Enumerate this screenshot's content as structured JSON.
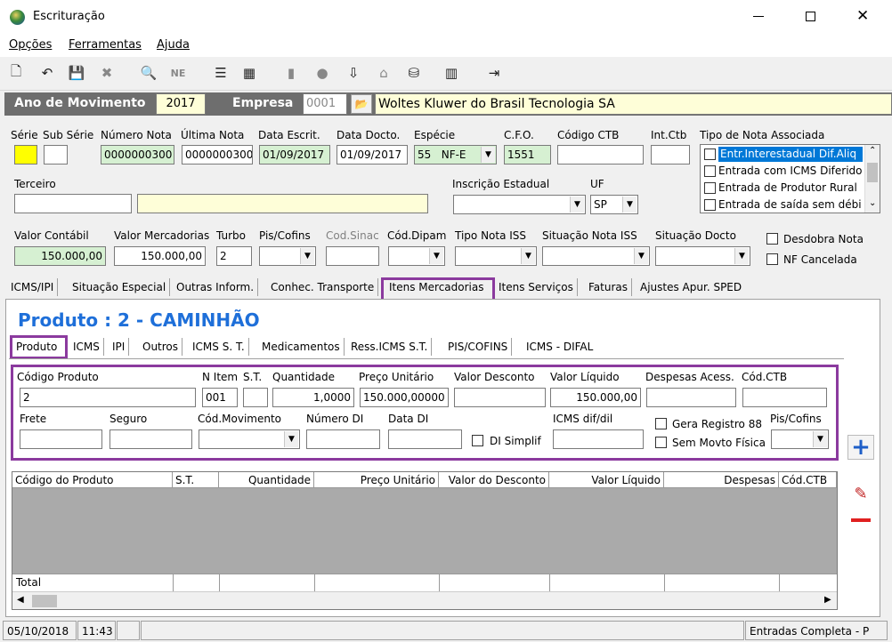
{
  "window": {
    "title": "Escrituração"
  },
  "menu": [
    "Opções",
    "Ferramentas",
    "Ajuda"
  ],
  "header": {
    "ano_label": "Ano de Movimento",
    "ano_value": "2017",
    "empresa_label": "Empresa",
    "empresa_code": "0001",
    "empresa_name": "Woltes Kluwer do Brasil Tecnologia SA"
  },
  "nota": {
    "serie_label": "Série",
    "sub_serie_label": "Sub Série",
    "numero_nota_label": "Número Nota",
    "numero_nota_value": "0000000300",
    "ultima_nota_label": "Última Nota",
    "ultima_nota_value": "0000000300",
    "data_escrit_label": "Data Escrit.",
    "data_escrit_value": "01/09/2017",
    "data_docto_label": "Data Docto.",
    "data_docto_value": "01/09/2017",
    "especie_label": "Espécie",
    "especie_value": "55   NF-E",
    "cfo_label": "C.F.O.",
    "cfo_value": "1551",
    "codigo_ctb_label": "Código CTB",
    "int_ctb_label": "Int.Ctb",
    "tipo_nota_label": "Tipo de Nota Associada",
    "tipo_nota_items": [
      "Entr.Interestadual Dif.Aliq",
      "Entrada com ICMS Diferido",
      "Entrada de Produtor Rural",
      "Entrada de saída sem débi"
    ],
    "terceiro_label": "Terceiro",
    "inscricao_label": "Inscrição Estadual",
    "uf_label": "UF",
    "uf_value": "SP",
    "valor_contabil_label": "Valor Contábil",
    "valor_contabil_value": "150.000,00",
    "valor_mercadorias_label": "Valor Mercadorias",
    "valor_mercadorias_value": "150.000,00",
    "turbo_label": "Turbo",
    "turbo_value": "2",
    "pis_cofins_label": "Pis/Cofins",
    "cod_sinac_label": "Cod.Sinac",
    "cod_dipam_label": "Cód.Dipam",
    "tipo_iss_label": "Tipo Nota ISS",
    "situacao_iss_label": "Situação Nota ISS",
    "situacao_docto_label": "Situação Docto",
    "desdobra_label": "Desdobra Nota",
    "nf_cancelada_label": "NF Cancelada"
  },
  "main_tabs": [
    "ICMS/IPI",
    "Situação Especial",
    "Outras Inform.",
    "Conhec. Transporte",
    "Itens Mercadorias",
    "Itens Serviços",
    "Faturas",
    "Ajustes Apur. SPED"
  ],
  "produto_title": "Produto : 2 - CAMINHÃO",
  "sub_tabs": [
    "Produto",
    "ICMS",
    "IPI",
    "Outros",
    "ICMS S. T.",
    "Medicamentos",
    "Ress.ICMS S.T.",
    "PIS/COFINS",
    "ICMS - DIFAL"
  ],
  "produto": {
    "codigo_label": "Código Produto",
    "codigo_value": "2",
    "n_item_label": "N Item",
    "n_item_value": "001",
    "st_label": "S.T.",
    "quantidade_label": "Quantidade",
    "quantidade_value": "1,0000",
    "preco_label": "Preço Unitário",
    "preco_value": "150.000,00000",
    "desconto_label": "Valor Desconto",
    "liquido_label": "Valor Líquido",
    "liquido_value": "150.000,00",
    "despesas_label": "Despesas Acess.",
    "cod_ctb_label": "Cód.CTB",
    "frete_label": "Frete",
    "seguro_label": "Seguro",
    "cod_movimento_label": "Cód.Movimento",
    "numero_di_label": "Número DI",
    "data_di_label": "Data DI",
    "di_simplif_label": "DI Simplif",
    "icms_dif_label": "ICMS dif/dil",
    "gera_registro_label": "Gera Registro 88",
    "sem_movto_label": "Sem Movto Física",
    "pis_cofins_label": "Pis/Cofins"
  },
  "grid": {
    "columns": [
      "Código do Produto",
      "S.T.",
      "Quantidade",
      "Preço Unitário",
      "Valor do Desconto",
      "Valor Líquido",
      "Despesas",
      "Cód.CTB"
    ],
    "total_label": "Total"
  },
  "status": {
    "date": "05/10/2018",
    "time": "11:43",
    "mode": "Entradas Completa - P"
  }
}
